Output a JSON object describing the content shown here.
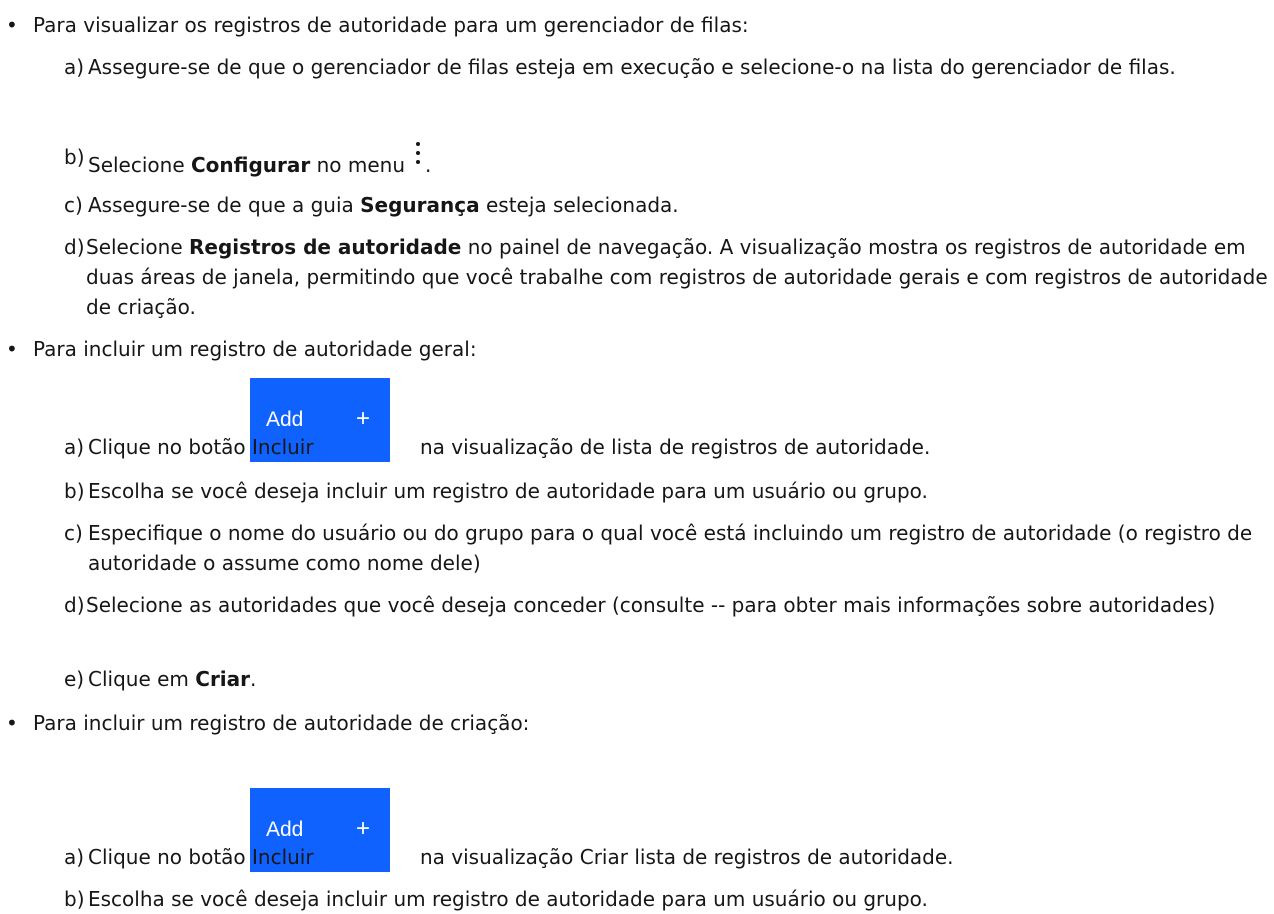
{
  "bullets": {
    "view": {
      "marker": "•",
      "text": "Para visualizar os registros de autoridade para um gerenciador de filas:"
    },
    "add_general": {
      "marker": "•",
      "text": "Para incluir um registro de autoridade geral:"
    },
    "add_create": {
      "marker": "•",
      "text": "Para incluir um registro de autoridade de criação:"
    }
  },
  "view_steps": {
    "a": {
      "label": "a)",
      "text": "Assegure-se de que o gerenciador de filas esteja em execução e selecione-o na lista do gerenciador de filas."
    },
    "b": {
      "label": "b)",
      "pre": "Selecione ",
      "bold": "Configurar",
      "post": " no menu",
      "end": "."
    },
    "c": {
      "label": "c)",
      "pre": "Assegure-se de que a guia ",
      "bold": "Segurança",
      "post": " esteja selecionada."
    },
    "d": {
      "label": "d)",
      "pre": "Selecione ",
      "bold": "Registros de autoridade",
      "post": " no painel de navegação. A visualização mostra os registros de autoridade em duas áreas de janela, permitindo que você trabalhe com registros de autoridade gerais e com registros de autoridade de criação."
    }
  },
  "general_steps": {
    "a": {
      "label": "a)",
      "pre": "Clique no botão Incluir",
      "post": "na visualização de lista de registros de autoridade."
    },
    "b": {
      "label": "b)",
      "text": "Escolha se você deseja incluir um registro de autoridade para um usuário ou grupo."
    },
    "c": {
      "label": "c)",
      "text": "Especifique o nome do usuário ou do grupo para o qual você está incluindo um registro de autoridade (o registro de autoridade o assume como nome dele)"
    },
    "d": {
      "label": "d)",
      "text": "Selecione as autoridades que você deseja conceder (consulte -- para obter mais informações sobre autoridades)"
    },
    "e": {
      "label": "e)",
      "pre": "Clique em ",
      "bold": "Criar",
      "post": "."
    }
  },
  "create_steps": {
    "a": {
      "label": "a)",
      "pre": "Clique no botão Incluir",
      "post": "na visualização Criar lista de registros de autoridade."
    },
    "b": {
      "label": "b)",
      "text": "Escolha se você deseja incluir um registro de autoridade para um usuário ou grupo."
    }
  },
  "add_button": {
    "label": "Add",
    "icon": "+"
  },
  "colors": {
    "button_bg": "#0f62fe",
    "button_text": "#ffffff",
    "text": "#161616"
  },
  "icons": {
    "overflow_menu": "kebab-menu-icon",
    "add": "plus-icon"
  }
}
